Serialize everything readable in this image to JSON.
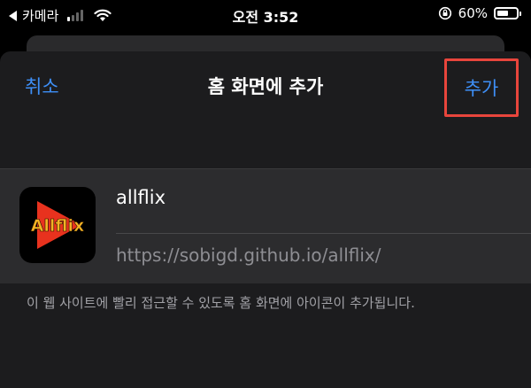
{
  "status_bar": {
    "back_app": "카메라",
    "time": "오전 3:52",
    "battery_percent": "60%",
    "battery_level": 0.6,
    "signal_bars_on": 1,
    "signal_bars_total": 4
  },
  "sheet": {
    "cancel_label": "취소",
    "title": "홈 화면에 추가",
    "add_label": "추가",
    "app_icon_text": "Allflix",
    "app_name": "allflix",
    "app_url": "https://sobigd.github.io/allflix/",
    "description": "이 웹 사이트에 빨리 접근할 수 있도록 홈 화면에 아이콘이 추가됩니다."
  },
  "colors": {
    "accent": "#3e8ff7",
    "highlight_border": "#e8453c",
    "icon_text": "#f5b324",
    "icon_play": "#e8321e"
  }
}
